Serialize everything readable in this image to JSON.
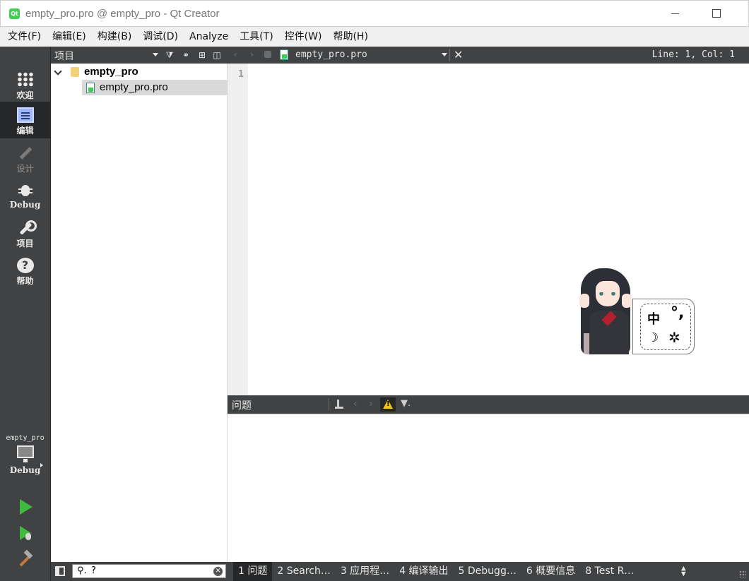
{
  "window": {
    "title": "empty_pro.pro @ empty_pro - Qt Creator",
    "app_icon_label": "Qt"
  },
  "menu": {
    "items": [
      "文件(F)",
      "编辑(E)",
      "构建(B)",
      "调试(D)",
      "Analyze",
      "工具(T)",
      "控件(W)",
      "帮助(H)"
    ]
  },
  "modes": [
    {
      "label": "欢迎",
      "icon": "grid-icon",
      "state": "normal"
    },
    {
      "label": "编辑",
      "icon": "edit-document-icon",
      "state": "active"
    },
    {
      "label": "设计",
      "icon": "pencil-icon",
      "state": "disabled"
    },
    {
      "label": "Debug",
      "icon": "bug-icon",
      "state": "normal"
    },
    {
      "label": "项目",
      "icon": "wrench-icon",
      "state": "normal"
    },
    {
      "label": "帮助",
      "icon": "help-icon",
      "state": "normal"
    }
  ],
  "target": {
    "project": "empty_pro",
    "config": "Debug"
  },
  "project_pane": {
    "view_selector": "项目",
    "tree": [
      {
        "label": "empty_pro",
        "type": "project",
        "expanded": true
      },
      {
        "label": "empty_pro.pro",
        "type": "file",
        "selected": true
      }
    ]
  },
  "editor": {
    "file_name": "empty_pro.pro",
    "line_col": "Line: 1, Col: 1",
    "line_numbers": [
      "1"
    ],
    "close_glyph": "✕"
  },
  "ime": {
    "mode_char": "中",
    "punct_char": "°,",
    "moon_glyph": "☽",
    "gear_glyph": "✲"
  },
  "issues_pane": {
    "title": "问题",
    "filter_glyph": "▼."
  },
  "statusbar": {
    "locator_icon": "⚲.",
    "locator_text": "?",
    "clear_glyph": "✕",
    "tabs": [
      {
        "label": "1 问题",
        "active": true
      },
      {
        "label": "2 Search…",
        "active": false
      },
      {
        "label": "3 应用程…",
        "active": false
      },
      {
        "label": "4 编译输出",
        "active": false
      },
      {
        "label": "5 Debugg…",
        "active": false
      },
      {
        "label": "6 概要信息",
        "active": false
      },
      {
        "label": "8 Test R…",
        "active": false
      }
    ]
  },
  "colors": {
    "sidebar_bg": "#404244",
    "sidebar_active": "#262728",
    "run_green": "#3fba3f"
  }
}
